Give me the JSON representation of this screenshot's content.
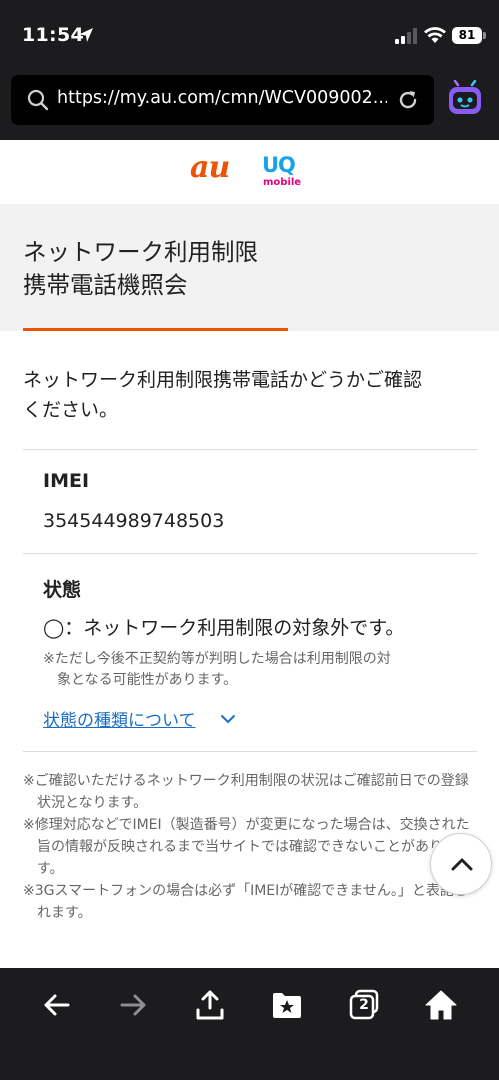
{
  "status_bar": {
    "time": "11:54",
    "battery": "81"
  },
  "browser": {
    "url": "https://my.au.com/cmn/WCV009002..."
  },
  "brand": {
    "au": "au",
    "uq": "UQ",
    "uq_sub": "mobile",
    "au_color": "#eb5505",
    "uq_color": "#1aa2e8",
    "accent": "#eb5505"
  },
  "page": {
    "title_line1": "ネットワーク利用制限",
    "title_line2": "携帯電話機照会",
    "intro_line1": "ネットワーク利用制限携帯電話かどうかご確認",
    "intro_line2": "ください。",
    "imei_label": "IMEI",
    "imei_value": "354544989748503",
    "status_label": "状態",
    "status_value": "◯：ネットワーク利用制限の対象外です。",
    "status_note_line1": "※ただし今後不正契約等が判明した場合は利用制限の対",
    "status_note_line2": "象となる可能性があります。",
    "status_link": "状態の種類について",
    "footnotes": [
      "※ご確認いただけるネットワーク利用制限の状況はご確認前日での登録状況となります。",
      "※修理対応などでIMEI（製造番号）が変更になった場合は、交換された旨の情報が反映されるまで当サイトでは確認できないことがあります。",
      "※3Gスマートフォンの場合は必ず「IMEIが確認できません。」と表記されます。"
    ]
  },
  "toolbar": {
    "tab_count": "2"
  }
}
